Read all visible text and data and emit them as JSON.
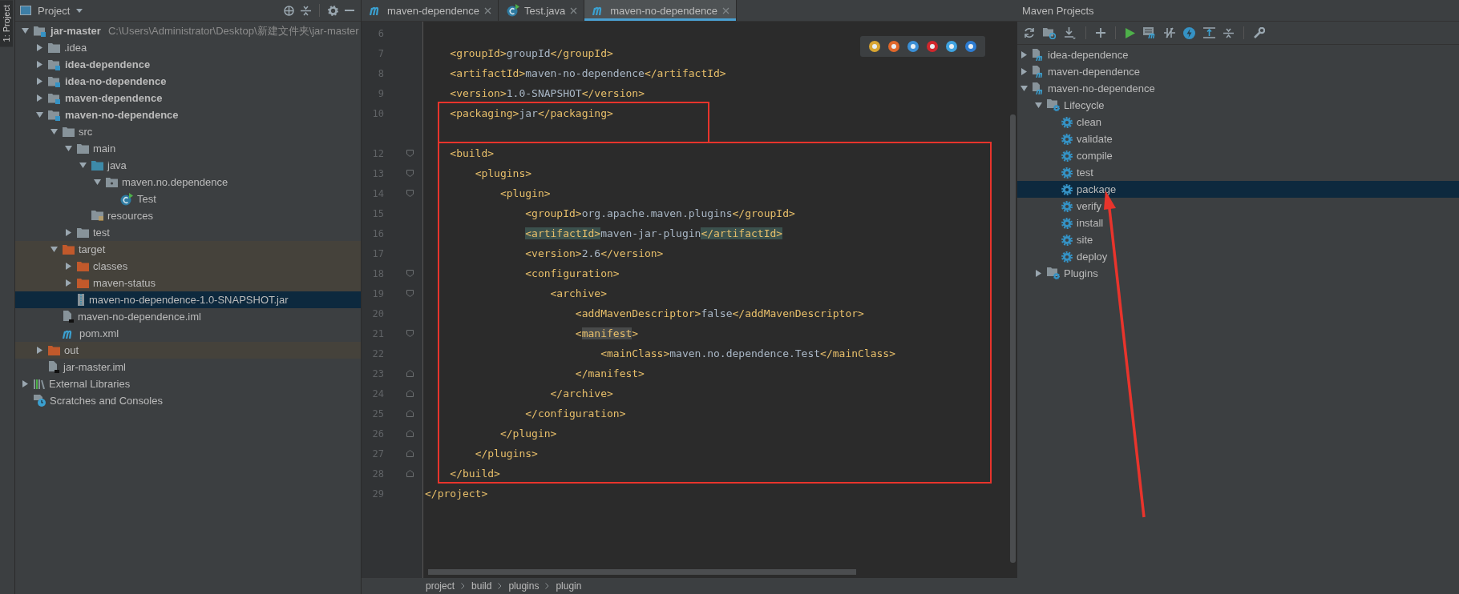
{
  "side_stripe": {
    "label": "1: Project"
  },
  "project_panel": {
    "title": "Project",
    "tree": [
      {
        "label": "jar-master",
        "path": "C:\\Users\\Administrator\\Desktop\\新建文件夹\\jar-master",
        "kind": "module",
        "expanded": true,
        "selected": false,
        "children": [
          {
            "label": ".idea",
            "kind": "folder",
            "expanded": false,
            "selected": false
          },
          {
            "label": "idea-dependence",
            "kind": "module",
            "expanded": false,
            "selected": false
          },
          {
            "label": "idea-no-dependence",
            "kind": "module",
            "expanded": false,
            "selected": false
          },
          {
            "label": "maven-dependence",
            "kind": "module",
            "expanded": false,
            "selected": false
          },
          {
            "label": "maven-no-dependence",
            "kind": "module",
            "expanded": true,
            "selected": false,
            "children": [
              {
                "label": "src",
                "kind": "folder",
                "expanded": true,
                "selected": false,
                "children": [
                  {
                    "label": "main",
                    "kind": "folder",
                    "expanded": true,
                    "selected": false,
                    "children": [
                      {
                        "label": "java",
                        "kind": "source",
                        "expanded": true,
                        "selected": false,
                        "children": [
                          {
                            "label": "maven.no.dependence",
                            "kind": "package",
                            "expanded": true,
                            "selected": false,
                            "children": [
                              {
                                "label": "Test",
                                "kind": "class",
                                "selected": false
                              }
                            ]
                          }
                        ]
                      },
                      {
                        "label": "resources",
                        "kind": "resources",
                        "selected": false
                      }
                    ]
                  },
                  {
                    "label": "test",
                    "kind": "folder",
                    "expanded": false,
                    "selected": false
                  }
                ]
              },
              {
                "label": "target",
                "kind": "excluded",
                "expanded": true,
                "selected": false,
                "children": [
                  {
                    "label": "classes",
                    "kind": "excluded",
                    "expanded": false,
                    "selected": false
                  },
                  {
                    "label": "maven-status",
                    "kind": "excluded",
                    "expanded": false,
                    "selected": false
                  },
                  {
                    "label": "maven-no-dependence-1.0-SNAPSHOT.jar",
                    "kind": "jar",
                    "selected": true
                  }
                ]
              },
              {
                "label": "maven-no-dependence.iml",
                "kind": "file",
                "selected": false
              },
              {
                "label": "pom.xml",
                "kind": "pom",
                "selected": false
              }
            ]
          },
          {
            "label": "out",
            "kind": "excluded",
            "expanded": false,
            "selected": false
          },
          {
            "label": "jar-master.iml",
            "kind": "file",
            "selected": false
          }
        ]
      },
      {
        "label": "External Libraries",
        "kind": "libraries",
        "expanded": false,
        "selected": false
      },
      {
        "label": "Scratches and Consoles",
        "kind": "scratches",
        "selected": false
      }
    ]
  },
  "editor": {
    "tabs": [
      {
        "label": "maven-dependence",
        "kind": "pom",
        "selected": false
      },
      {
        "label": "Test.java",
        "kind": "class",
        "selected": false
      },
      {
        "label": "maven-no-dependence",
        "kind": "pom",
        "selected": true
      }
    ],
    "blocks": [
      {
        "marked": false,
        "lines": [
          {
            "number": "6",
            "kind": "plain"
          },
          {
            "number": "7",
            "kind": "plain",
            "parts": [
              {
                "kind": "tag",
                "text": "    <groupId>"
              },
              {
                "kind": "text",
                "text": "groupId"
              },
              {
                "kind": "tag",
                "text": "</groupId>"
              }
            ]
          },
          {
            "number": "8",
            "kind": "plain",
            "parts": [
              {
                "kind": "tag",
                "text": "    <artifactId>"
              },
              {
                "kind": "text",
                "text": "maven-no-dependence"
              },
              {
                "kind": "tag",
                "text": "</artifactId>"
              }
            ]
          },
          {
            "number": "9",
            "kind": "plain",
            "parts": [
              {
                "kind": "tag",
                "text": "    <version>"
              },
              {
                "kind": "text",
                "text": "1.0-SNAPSHOT"
              },
              {
                "kind": "tag",
                "text": "</version>"
              }
            ]
          }
        ]
      },
      {
        "marked": true,
        "lines": [
          {
            "number": "10",
            "kind": "plain",
            "parts": [
              {
                "kind": "tag",
                "text": "    <packaging>"
              },
              {
                "kind": "text",
                "text": "jar"
              },
              {
                "kind": "tag",
                "text": "</packaging>"
              }
            ]
          },
          {
            "kind": "plain"
          }
        ]
      },
      {
        "marked": true,
        "lines": [
          {
            "number": "12",
            "kind": "fold-start",
            "parts": [
              {
                "kind": "tag",
                "text": "    <build>"
              }
            ]
          },
          {
            "number": "13",
            "kind": "fold-start",
            "parts": [
              {
                "kind": "tag",
                "text": "        <plugins>"
              }
            ]
          },
          {
            "number": "14",
            "kind": "fold-start",
            "parts": [
              {
                "kind": "tag",
                "text": "            <plugin>"
              }
            ]
          },
          {
            "number": "15",
            "kind": "plain",
            "parts": [
              {
                "kind": "tag",
                "text": "                <groupId>"
              },
              {
                "kind": "text",
                "text": "org.apache.maven.plugins"
              },
              {
                "kind": "tag",
                "text": "</groupId>"
              }
            ]
          },
          {
            "number": "16",
            "kind": "plain",
            "parts": [
              {
                "kind": "match",
                "text": "                <artifactId>"
              },
              {
                "kind": "text",
                "text": "maven-jar-plugin"
              },
              {
                "kind": "match",
                "text": "</artifactId>"
              }
            ]
          },
          {
            "number": "17",
            "kind": "plain",
            "parts": [
              {
                "kind": "tag",
                "text": "                <version>"
              },
              {
                "kind": "text",
                "text": "2.6"
              },
              {
                "kind": "tag",
                "text": "</version>"
              }
            ]
          },
          {
            "number": "18",
            "kind": "fold-start",
            "parts": [
              {
                "kind": "tag",
                "text": "                <configuration>"
              }
            ]
          },
          {
            "number": "19",
            "kind": "fold-start",
            "parts": [
              {
                "kind": "tag",
                "text": "                    <archive>"
              }
            ]
          },
          {
            "number": "20",
            "kind": "plain",
            "parts": [
              {
                "kind": "tag",
                "text": "                        <addMavenDescriptor>"
              },
              {
                "kind": "text",
                "text": "false"
              },
              {
                "kind": "tag",
                "text": "</addMavenDescriptor>"
              }
            ]
          },
          {
            "number": "21",
            "kind": "fold-start",
            "parts": [
              {
                "kind": "tag",
                "text": "                        <"
              },
              {
                "kind": "hover",
                "text": "manifest"
              },
              {
                "kind": "tag",
                "text": ">"
              }
            ]
          },
          {
            "number": "22",
            "kind": "plain",
            "parts": [
              {
                "kind": "tag",
                "text": "                            <mainClass>"
              },
              {
                "kind": "text",
                "text": "maven.no.dependence.Test"
              },
              {
                "kind": "tag",
                "text": "</mainClass>"
              }
            ]
          },
          {
            "number": "23",
            "kind": "fold-end",
            "parts": [
              {
                "kind": "tag",
                "text": "                        </manifest>"
              }
            ]
          },
          {
            "number": "24",
            "kind": "fold-end",
            "parts": [
              {
                "kind": "tag",
                "text": "                    </archive>"
              }
            ]
          },
          {
            "number": "25",
            "kind": "fold-end",
            "parts": [
              {
                "kind": "tag",
                "text": "                </configuration>"
              }
            ]
          },
          {
            "number": "26",
            "kind": "fold-end",
            "parts": [
              {
                "kind": "tag",
                "text": "            </plugin>"
              }
            ]
          },
          {
            "number": "27",
            "kind": "fold-end",
            "parts": [
              {
                "kind": "tag",
                "text": "        </plugins>"
              }
            ]
          },
          {
            "number": "28",
            "kind": "fold-end",
            "parts": [
              {
                "kind": "tag",
                "text": "    </build>"
              }
            ]
          }
        ]
      },
      {
        "marked": false,
        "lines": [
          {
            "number": "29",
            "kind": "plain",
            "parts": [
              {
                "kind": "tag",
                "text": "</project>"
              }
            ]
          }
        ]
      }
    ],
    "breadcrumbs": [
      "project",
      "build",
      "plugins",
      "plugin"
    ]
  },
  "maven_panel": {
    "title": "Maven Projects",
    "tree": [
      {
        "label": "idea-dependence",
        "kind": "project",
        "expanded": false,
        "selected": false,
        "marked": false
      },
      {
        "label": "maven-dependence",
        "kind": "project",
        "expanded": false,
        "selected": false,
        "marked": false
      },
      {
        "label": "maven-no-dependence",
        "kind": "project",
        "expanded": true,
        "selected": false,
        "marked": false,
        "children": [
          {
            "label": "Lifecycle",
            "kind": "group",
            "expanded": true,
            "selected": false,
            "marked": false,
            "children": [
              {
                "label": "clean",
                "kind": "goal",
                "selected": false,
                "marked": false
              },
              {
                "label": "validate",
                "kind": "goal",
                "selected": false,
                "marked": false
              },
              {
                "label": "compile",
                "kind": "goal",
                "selected": false,
                "marked": false
              },
              {
                "label": "test",
                "kind": "goal",
                "selected": false,
                "marked": false
              },
              {
                "label": "package",
                "kind": "goal",
                "selected": true,
                "marked": true
              },
              {
                "label": "verify",
                "kind": "goal",
                "selected": false,
                "marked": false
              },
              {
                "label": "install",
                "kind": "goal",
                "selected": false,
                "marked": false
              },
              {
                "label": "site",
                "kind": "goal",
                "selected": false,
                "marked": false
              },
              {
                "label": "deploy",
                "kind": "goal",
                "selected": false,
                "marked": false
              }
            ]
          },
          {
            "label": "Plugins",
            "kind": "group",
            "expanded": false,
            "selected": false,
            "marked": false
          }
        ]
      }
    ]
  }
}
